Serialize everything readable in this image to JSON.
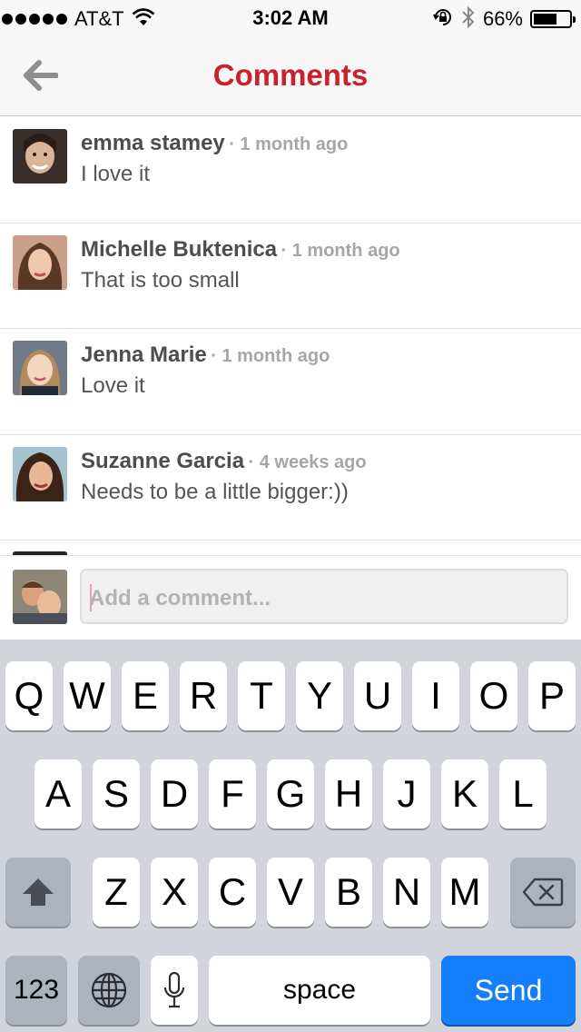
{
  "status_bar": {
    "carrier": "AT&T",
    "time": "3:02 AM",
    "battery_percent": "66%",
    "battery_level": 0.66,
    "icons": [
      "signal-icon",
      "wifi-icon",
      "rotation-lock-icon",
      "bluetooth-icon",
      "battery-icon"
    ]
  },
  "nav": {
    "title": "Comments",
    "back_icon": "back-arrow-icon"
  },
  "colors": {
    "title": "#c8232c",
    "send_key": "#147efb",
    "keyboard_bg": "#d1d5db"
  },
  "comments": [
    {
      "name": "emma stamey",
      "time": "· 1 month ago",
      "text": "I love it"
    },
    {
      "name": "Michelle Buktenica",
      "time": "· 1 month ago",
      "text": "That is too small"
    },
    {
      "name": "Jenna Marie",
      "time": "· 1 month ago",
      "text": "Love it"
    },
    {
      "name": "Suzanne Garcia",
      "time": "· 4 weeks ago",
      "text": "Needs to be a little bigger:))"
    }
  ],
  "composer": {
    "placeholder": "Add a comment..."
  },
  "keyboard": {
    "row1": [
      "Q",
      "W",
      "E",
      "R",
      "T",
      "Y",
      "U",
      "I",
      "O",
      "P"
    ],
    "row2": [
      "A",
      "S",
      "D",
      "F",
      "G",
      "H",
      "J",
      "K",
      "L"
    ],
    "row3": [
      "Z",
      "X",
      "C",
      "V",
      "B",
      "N",
      "M"
    ],
    "numbers_label": "123",
    "space_label": "space",
    "send_label": "Send"
  }
}
